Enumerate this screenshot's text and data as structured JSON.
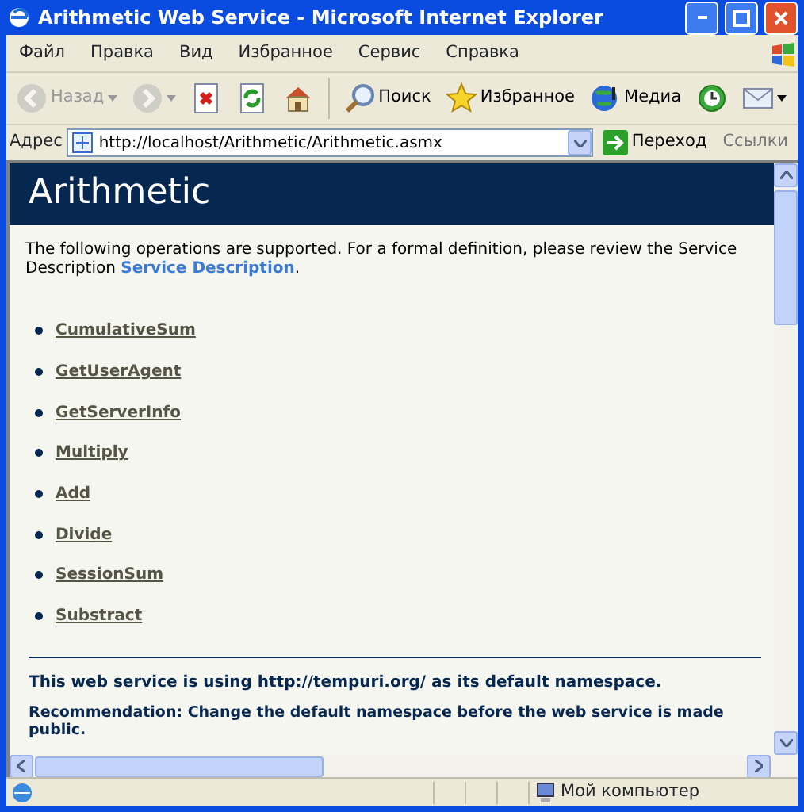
{
  "window": {
    "title": "Arithmetic Web Service - Microsoft Internet Explorer"
  },
  "menu": [
    "Файл",
    "Правка",
    "Вид",
    "Избранное",
    "Сервис",
    "Справка"
  ],
  "toolbar": [
    {
      "kind": "back",
      "label": "Назад",
      "disabled": true
    },
    {
      "kind": "forward",
      "disabled": true
    },
    {
      "kind": "stop",
      "disabled": false
    },
    {
      "kind": "refresh",
      "disabled": false
    },
    {
      "kind": "home",
      "disabled": false
    },
    {
      "kind": "search",
      "label": "Поиск",
      "disabled": false
    },
    {
      "kind": "favorites",
      "label": "Избранное",
      "disabled": false
    },
    {
      "kind": "media",
      "label": "Медиа",
      "disabled": false
    },
    {
      "kind": "history",
      "disabled": false
    },
    {
      "kind": "mail",
      "disabled": false
    }
  ],
  "address_bar": {
    "label": "Адрес",
    "url": "http://localhost/Arithmetic/Arithmetic.asmx",
    "go": "Переход",
    "links": "Ссылки"
  },
  "page": {
    "heading": "Arithmetic",
    "intro": "The following operations are supported. For a formal definition, please review the Service Description",
    "intro_link": "Service Description",
    "intro_end": ".",
    "operations": [
      "CumulativeSum",
      "GetUserAgent",
      "GetServerInfo",
      "Multiply",
      "Add",
      "Divide",
      "SessionSum",
      "Substract"
    ],
    "namespace_note": "This web service is using http://tempuri.org/ as its default namespace.",
    "recommendation": "Recommendation: Change the default namespace before the web service is made public."
  },
  "status_bar": {
    "zone": "Мой компьютер"
  }
}
